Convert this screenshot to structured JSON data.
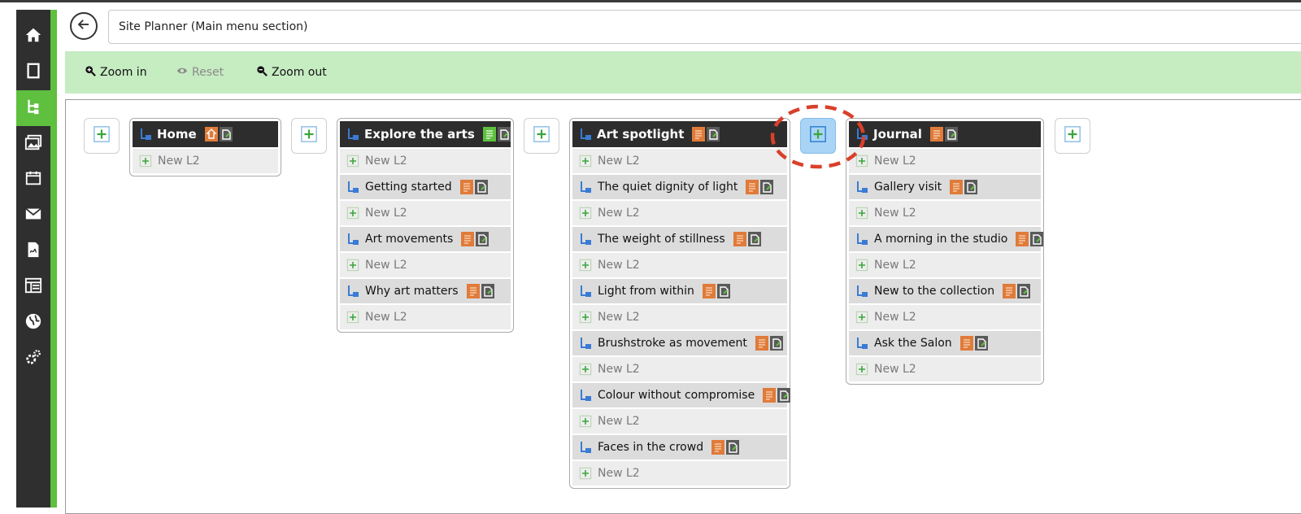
{
  "header": {
    "title": "Site Planner (Main menu section)"
  },
  "toolbar": {
    "zoom_in": "Zoom in",
    "reset": "Reset",
    "zoom_out": "Zoom out"
  },
  "sidebar": {
    "items": [
      {
        "icon": "home-icon"
      },
      {
        "icon": "page-icon"
      },
      {
        "icon": "sitemap-icon",
        "active": true
      },
      {
        "icon": "gallery-icon"
      },
      {
        "icon": "calendar-icon"
      },
      {
        "icon": "mail-icon"
      },
      {
        "icon": "document-icon"
      },
      {
        "icon": "layout-icon"
      },
      {
        "icon": "globe-icon"
      },
      {
        "icon": "settings-icon"
      }
    ]
  },
  "columns": [
    {
      "title": "Home",
      "rows": [
        {
          "type": "new",
          "label": "New L2"
        }
      ]
    },
    {
      "title": "Explore the arts",
      "rows": [
        {
          "type": "new",
          "label": "New L2"
        },
        {
          "type": "page",
          "label": "Getting started"
        },
        {
          "type": "new",
          "label": "New L2"
        },
        {
          "type": "page",
          "label": "Art movements"
        },
        {
          "type": "new",
          "label": "New L2"
        },
        {
          "type": "page",
          "label": "Why art matters"
        },
        {
          "type": "new",
          "label": "New L2"
        }
      ]
    },
    {
      "title": "Art spotlight",
      "rows": [
        {
          "type": "new",
          "label": "New L2"
        },
        {
          "type": "page",
          "label": "The quiet dignity of light"
        },
        {
          "type": "new",
          "label": "New L2"
        },
        {
          "type": "page",
          "label": "The weight of stillness"
        },
        {
          "type": "new",
          "label": "New L2"
        },
        {
          "type": "page",
          "label": "Light from within"
        },
        {
          "type": "new",
          "label": "New L2"
        },
        {
          "type": "page",
          "label": "Brushstroke as movement"
        },
        {
          "type": "new",
          "label": "New L2"
        },
        {
          "type": "page",
          "label": "Colour without compromise"
        },
        {
          "type": "new",
          "label": "New L2"
        },
        {
          "type": "page",
          "label": "Faces in the crowd"
        },
        {
          "type": "new",
          "label": "New L2"
        }
      ]
    },
    {
      "title": "Journal",
      "rows": [
        {
          "type": "new",
          "label": "New L2"
        },
        {
          "type": "page",
          "label": "Gallery visit"
        },
        {
          "type": "new",
          "label": "New L2"
        },
        {
          "type": "page",
          "label": "A morning in the studio"
        },
        {
          "type": "new",
          "label": "New L2"
        },
        {
          "type": "page",
          "label": "New to the collection"
        },
        {
          "type": "new",
          "label": "New L2"
        },
        {
          "type": "page",
          "label": "Ask the Salon"
        },
        {
          "type": "new",
          "label": "New L2"
        }
      ]
    }
  ],
  "colors": {
    "accent": "#5fbf3f",
    "toolbar_bg": "#c6ecc2",
    "highlight": "#a9d4f5",
    "annotation": "#d9402b"
  }
}
